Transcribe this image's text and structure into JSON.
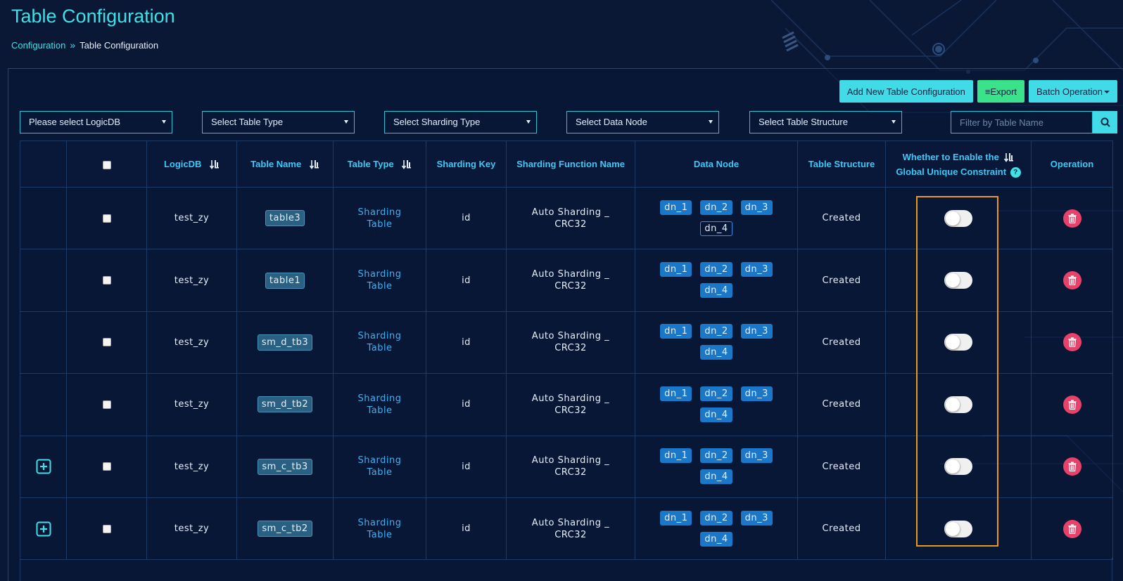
{
  "header": {
    "title": "Table Configuration",
    "breadcrumb": {
      "parent": "Configuration",
      "separator": "»",
      "current": "Table Configuration"
    }
  },
  "actions": {
    "add_label": "Add New Table Configuration",
    "export_label": "≡Export",
    "batch_label": "Batch Operation"
  },
  "filters": {
    "logicdb": "Please select LogicDB",
    "table_type": "Select Table Type",
    "sharding_type": "Select Sharding Type",
    "data_node": "Select Data Node",
    "table_structure": "Select Table Structure",
    "search_placeholder": "Filter by Table Name"
  },
  "table": {
    "headers": {
      "logicdb": "LogicDB",
      "table_name": "Table Name",
      "table_type": "Table Type",
      "sharding_key": "Sharding Key",
      "sharding_function": "Sharding Function Name",
      "data_node": "Data Node",
      "table_structure": "Table Structure",
      "unique_line1": "Whether to Enable the",
      "unique_line2": "Global Unique Constraint",
      "unique_help": "?",
      "operation": "Operation"
    },
    "rows": [
      {
        "expand": false,
        "logicdb": "test_zy",
        "table_name": "table3",
        "type1": "Sharding",
        "type2": "Table",
        "key": "id",
        "func1": "Auto Sharding _",
        "func2": "CRC32",
        "nodes": [
          "dn_1",
          "dn_2",
          "dn_3",
          "dn_4"
        ],
        "structure": "Created",
        "unique_enabled": false
      },
      {
        "expand": false,
        "logicdb": "test_zy",
        "table_name": "table1",
        "type1": "Sharding",
        "type2": "Table",
        "key": "id",
        "func1": "Auto Sharding _",
        "func2": "CRC32",
        "nodes": [
          "dn_1",
          "dn_2",
          "dn_3",
          "dn_4"
        ],
        "structure": "Created",
        "unique_enabled": false
      },
      {
        "expand": false,
        "logicdb": "test_zy",
        "table_name": "sm_d_tb3",
        "type1": "Sharding",
        "type2": "Table",
        "key": "id",
        "func1": "Auto Sharding _",
        "func2": "CRC32",
        "nodes": [
          "dn_1",
          "dn_2",
          "dn_3",
          "dn_4"
        ],
        "structure": "Created",
        "unique_enabled": false
      },
      {
        "expand": false,
        "logicdb": "test_zy",
        "table_name": "sm_d_tb2",
        "type1": "Sharding",
        "type2": "Table",
        "key": "id",
        "func1": "Auto Sharding _",
        "func2": "CRC32",
        "nodes": [
          "dn_1",
          "dn_2",
          "dn_3",
          "dn_4"
        ],
        "structure": "Created",
        "unique_enabled": false
      },
      {
        "expand": true,
        "logicdb": "test_zy",
        "table_name": "sm_c_tb3",
        "type1": "Sharding",
        "type2": "Table",
        "key": "id",
        "func1": "Auto Sharding _",
        "func2": "CRC32",
        "nodes": [
          "dn_1",
          "dn_2",
          "dn_3",
          "dn_4"
        ],
        "structure": "Created",
        "unique_enabled": false
      },
      {
        "expand": true,
        "logicdb": "test_zy",
        "table_name": "sm_c_tb2",
        "type1": "Sharding",
        "type2": "Table",
        "key": "id",
        "func1": "Auto Sharding _",
        "func2": "CRC32",
        "nodes": [
          "dn_1",
          "dn_2",
          "dn_3",
          "dn_4"
        ],
        "structure": "Created",
        "unique_enabled": false
      }
    ]
  },
  "colors": {
    "accent": "#3fe0e6",
    "header_text": "#3fc8f5",
    "node_badge": "#1b77c8",
    "delete": "#e8426a",
    "highlight": "#e89a1c"
  }
}
